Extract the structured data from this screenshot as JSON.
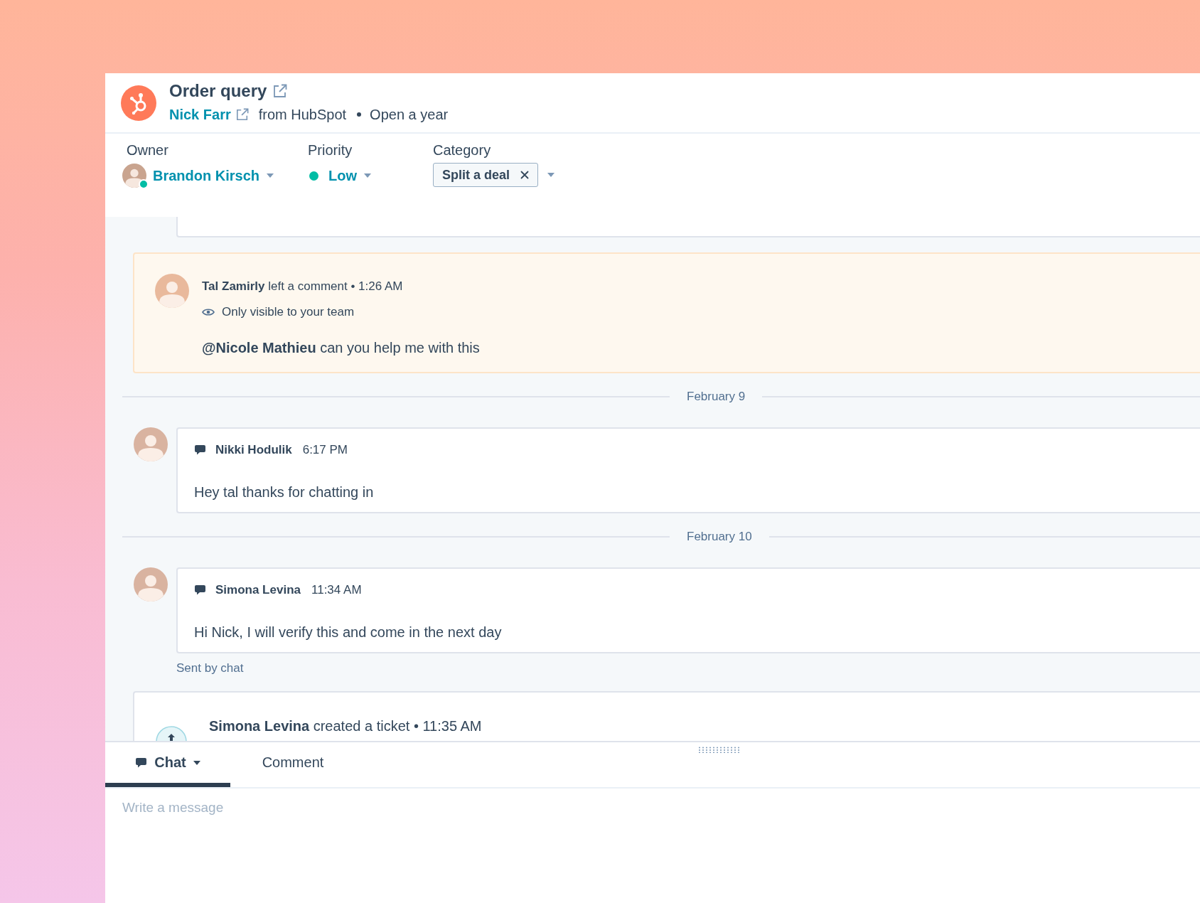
{
  "ticket": {
    "title": "Order query",
    "contact": "Nick Farr",
    "source": "from HubSpot",
    "status": "Open a year"
  },
  "fields": [
    {
      "kind": "owner",
      "label": "Owner",
      "value": "Brandon Kirsch",
      "online": true
    },
    {
      "kind": "priority",
      "label": "Priority",
      "value": "Low",
      "color": "#00bda5"
    },
    {
      "kind": "category",
      "label": "Category",
      "tags": [
        "Split a deal"
      ]
    }
  ],
  "feed": [
    {
      "kind": "clipped_message"
    },
    {
      "kind": "comment",
      "headline": "**Tal Zamirly** left a comment • 1:26 AM",
      "visibility": "Only visible to your team",
      "body": "**@Nicole Mathieu** can you help me with this"
    },
    {
      "kind": "date",
      "label": "February 9"
    },
    {
      "kind": "chat",
      "author": "Nikki Hodulik",
      "time": "6:17 PM",
      "body": "Hey tal thanks for chatting in"
    },
    {
      "kind": "date",
      "label": "February 10"
    },
    {
      "kind": "chat",
      "author": "Simona Levina",
      "time": "11:34 AM",
      "body": "Hi Nick, I will verify this and come in the next day",
      "note": "Sent by chat"
    },
    {
      "kind": "event",
      "headline": "**Simona Levina** created a ticket • 11:35 AM"
    }
  ],
  "composer": {
    "tabs": [
      {
        "kind": "chat",
        "label": "Chat",
        "selected": true
      },
      {
        "kind": "comment",
        "label": "Comment",
        "selected": false
      }
    ],
    "placeholder": "Write a message"
  }
}
